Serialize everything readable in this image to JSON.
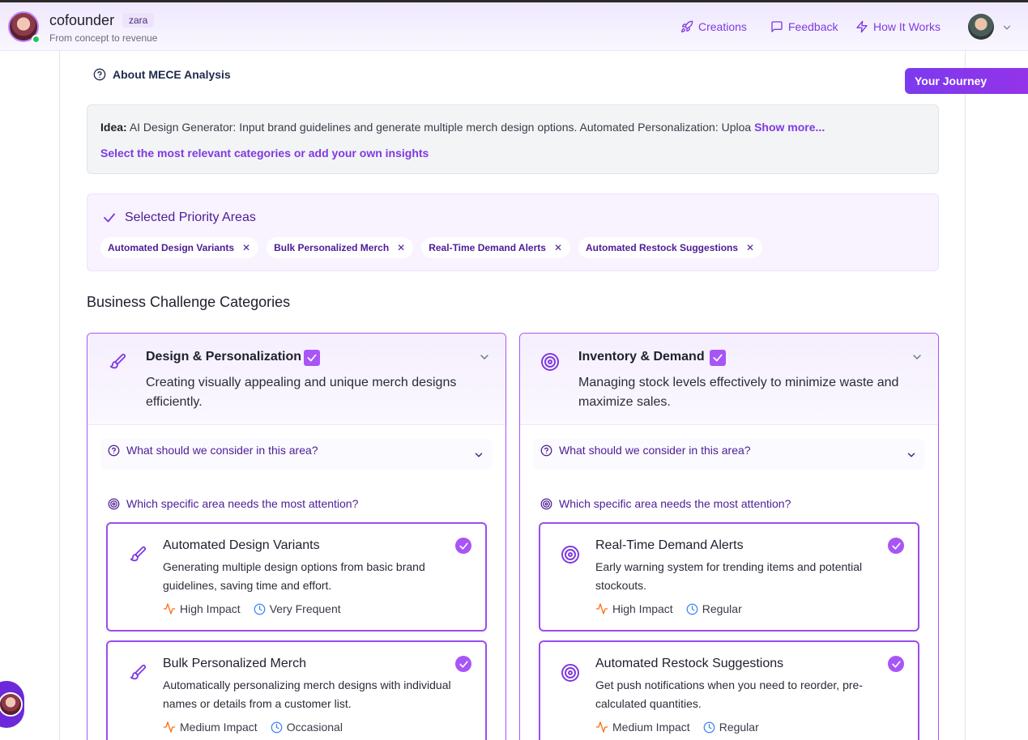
{
  "header": {
    "brand": "cofounder",
    "badge": "zara",
    "tagline": "From concept to revenue",
    "nav": [
      {
        "label": "Creations",
        "icon": "rocket-icon"
      },
      {
        "label": "Feedback",
        "icon": "message-icon"
      },
      {
        "label": "How It Works",
        "icon": "lightning-icon"
      }
    ]
  },
  "about_link": "About MECE Analysis",
  "journey_button": "Your Journey",
  "idea": {
    "label": "Idea:",
    "text": "AI Design Generator: Input brand guidelines and generate multiple merch design options. Automated Personalization: Uploa",
    "show_more": "Show more...",
    "hint": "Select the most relevant categories or add your own insights"
  },
  "priority": {
    "title": "Selected Priority Areas",
    "chips": [
      "Automated Design Variants",
      "Bulk Personalized Merch",
      "Real-Time Demand Alerts",
      "Automated Restock Suggestions"
    ]
  },
  "section_title": "Business Challenge Categories",
  "categories": [
    {
      "title": "Design & Personalization",
      "desc": "Creating visually appealing and unique merch designs efficiently.",
      "consider": "What should we consider in this area?",
      "which": "Which specific area needs the most attention?",
      "items": [
        {
          "title": "Automated Design Variants",
          "desc": "Generating multiple design options from basic brand guidelines, saving time and effort.",
          "impact": "High Impact",
          "frequency": "Very Frequent"
        },
        {
          "title": "Bulk Personalized Merch",
          "desc": "Automatically personalizing merch designs with individual names or details from a customer list.",
          "impact": "Medium Impact",
          "frequency": "Occasional"
        }
      ]
    },
    {
      "title": "Inventory & Demand",
      "desc": "Managing stock levels effectively to minimize waste and maximize sales.",
      "consider": "What should we consider in this area?",
      "which": "Which specific area needs the most attention?",
      "items": [
        {
          "title": "Real-Time Demand Alerts",
          "desc": "Early warning system for trending items and potential stockouts.",
          "impact": "High Impact",
          "frequency": "Regular"
        },
        {
          "title": "Automated Restock Suggestions",
          "desc": "Get push notifications when you need to reorder, pre-calculated quantities.",
          "impact": "Medium Impact",
          "frequency": "Regular"
        }
      ]
    }
  ],
  "colors": {
    "accent": "#a855f7",
    "accent_dark": "#7e3ae0",
    "impact": "#f97316",
    "frequency": "#3b82f6"
  }
}
